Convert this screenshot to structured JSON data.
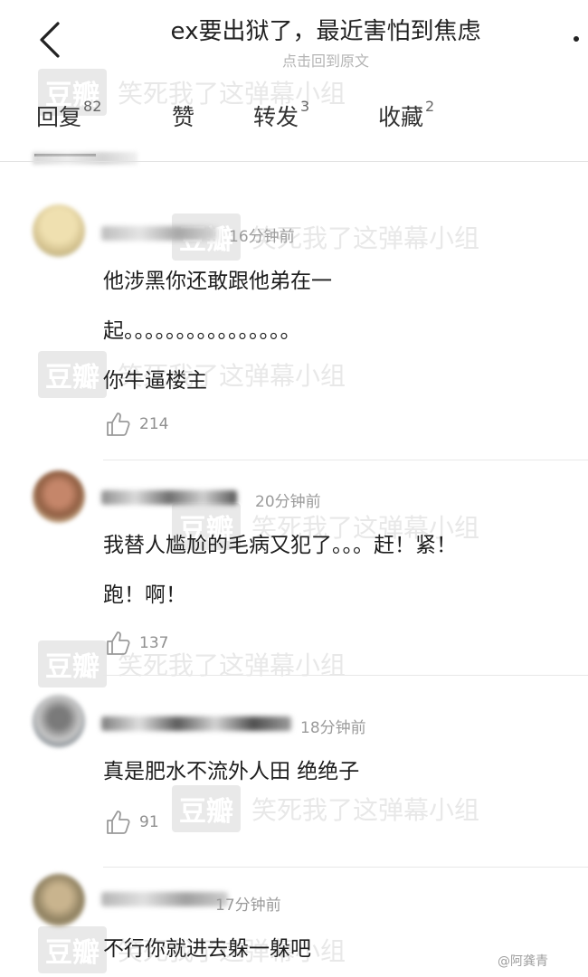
{
  "header": {
    "title": "ex要出狱了，最近害怕到焦虑",
    "subtitle": "点击回到原文"
  },
  "tabs": [
    {
      "label": "回复",
      "count": "82"
    },
    {
      "label": "赞",
      "count": ""
    },
    {
      "label": "转发",
      "count": "3"
    },
    {
      "label": "收藏",
      "count": "2"
    }
  ],
  "watermark": {
    "badge": "豆瓣",
    "group": "笑死我了这弹幕小组"
  },
  "comments": [
    {
      "time": "16分钟前",
      "lines": [
        "他涉黑你还敢跟他弟在一",
        "起。。。。。。。。。。。。。。。。",
        "你牛逼楼主"
      ],
      "likes": "214"
    },
    {
      "time": "20分钟前",
      "lines": [
        "我替人尴尬的毛病又犯了。。。赶！紧！",
        "跑！啊！"
      ],
      "likes": "137"
    },
    {
      "time": "18分钟前",
      "lines": [
        "真是肥水不流外人田 绝绝子"
      ],
      "likes": "91"
    },
    {
      "time": "17分钟前",
      "lines": [
        "不行你就进去躲一躲吧"
      ],
      "likes": ""
    }
  ],
  "corner_watermark": "@阿龚青"
}
